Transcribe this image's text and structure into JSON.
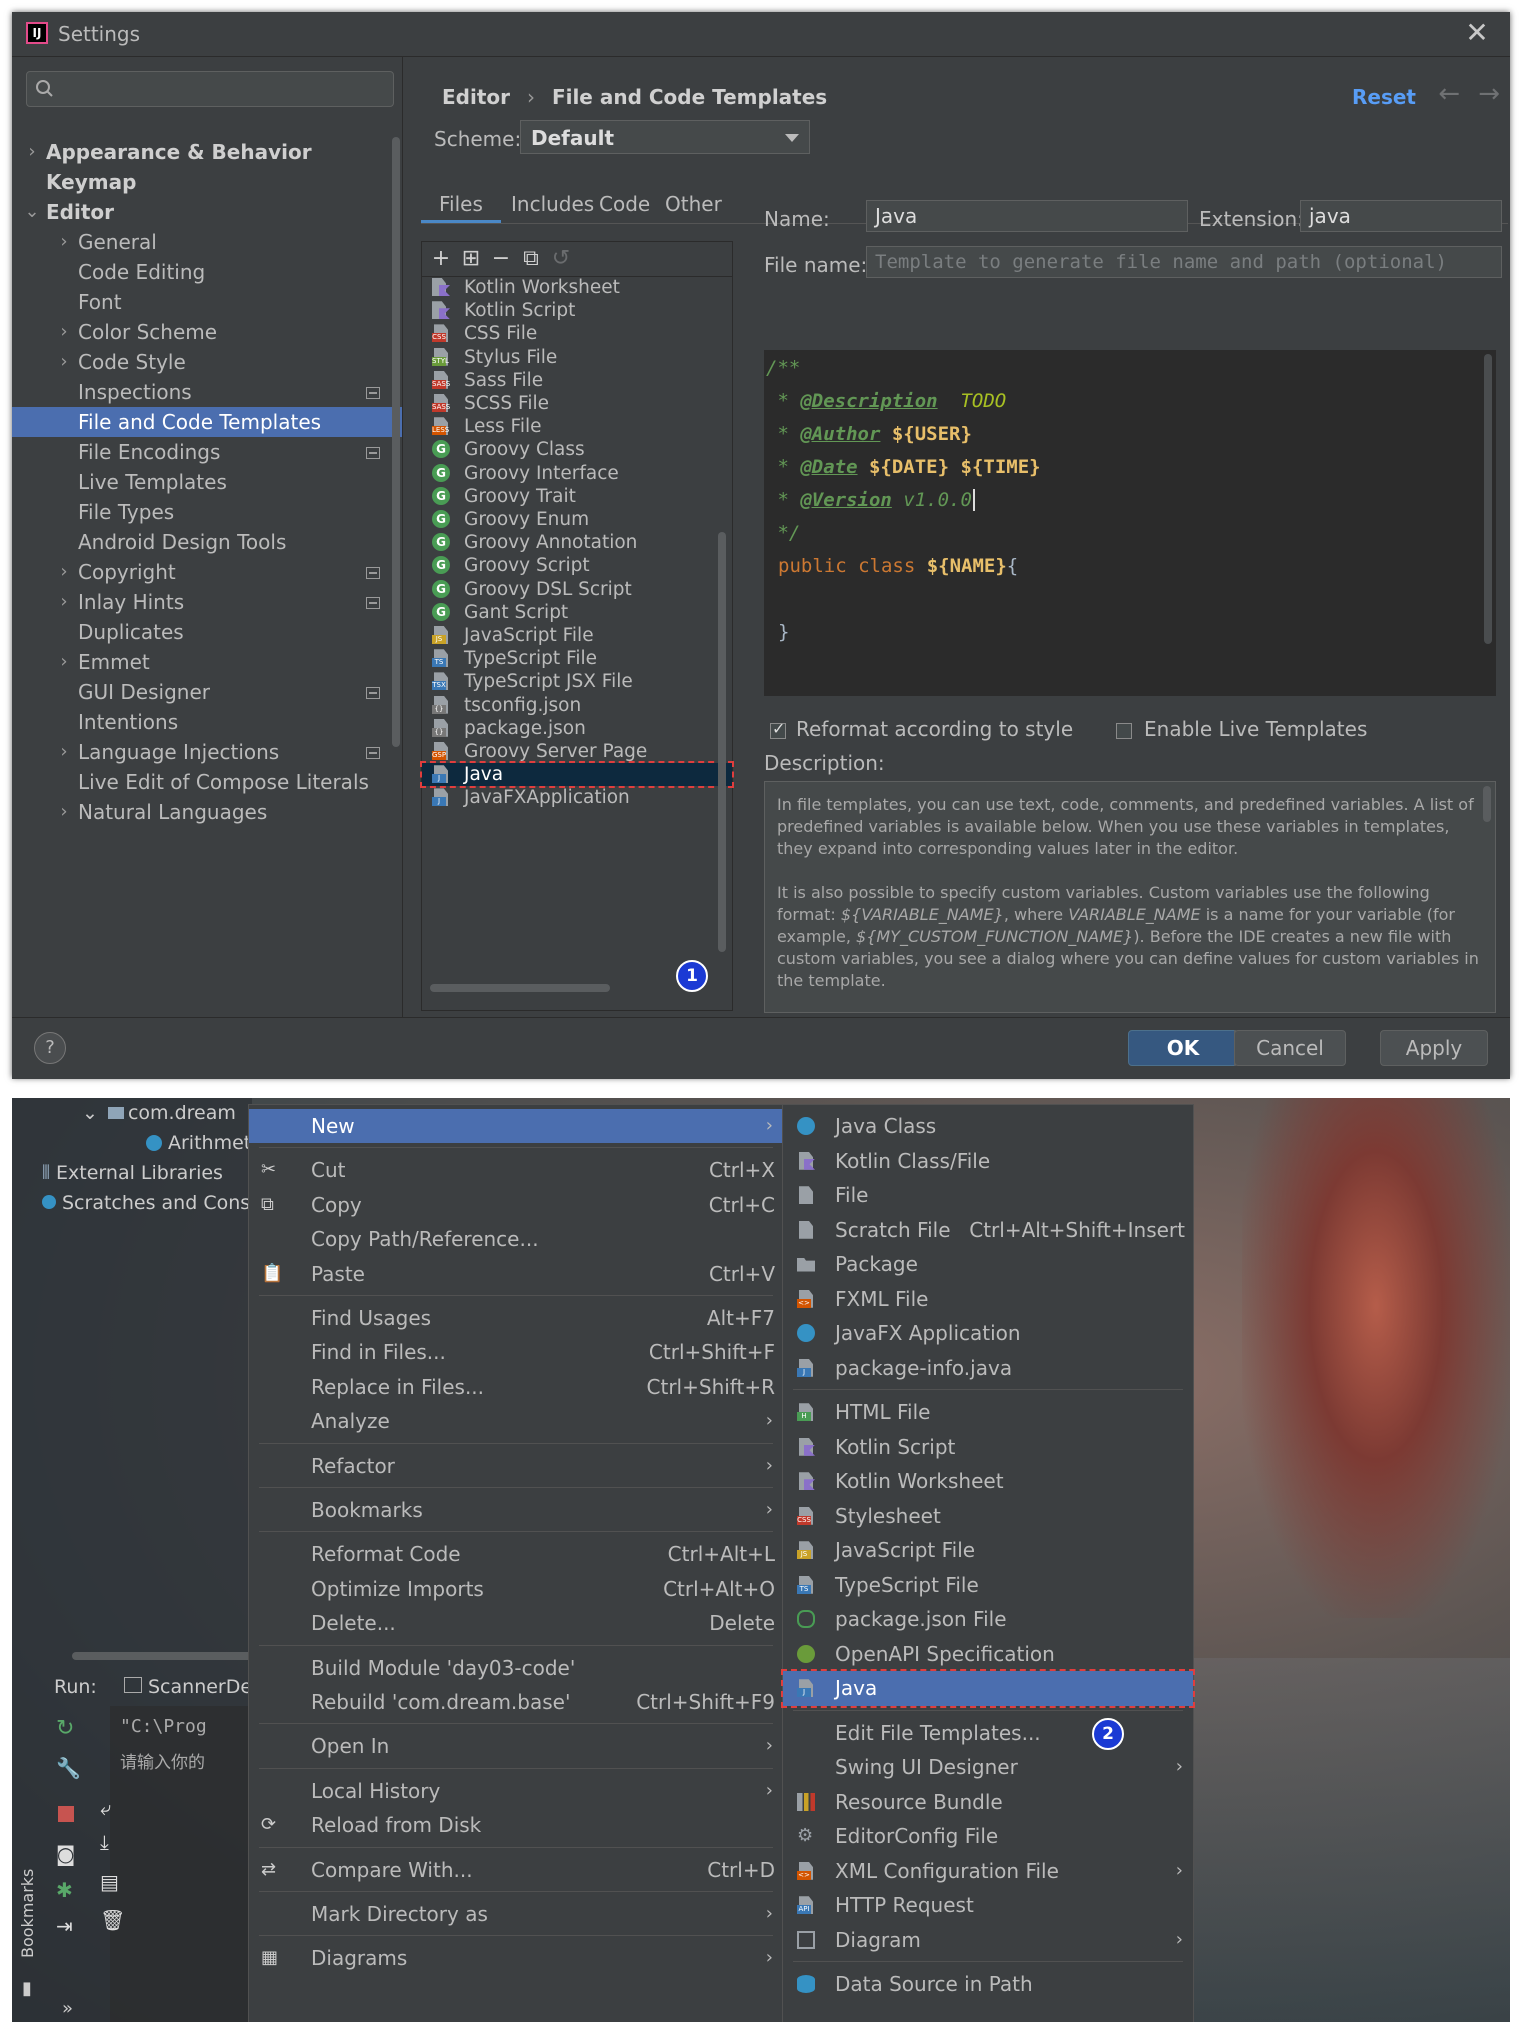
{
  "settings": {
    "title": "Settings",
    "close_symbol": "✕",
    "search_placeholder": "",
    "nav": [
      {
        "label": "Appearance & Behavior",
        "arrow": "›",
        "indent": 0,
        "bold": true
      },
      {
        "label": "Keymap",
        "arrow": "",
        "indent": 0,
        "bold": true
      },
      {
        "label": "Editor",
        "arrow": "⌄",
        "indent": 0,
        "bold": true
      },
      {
        "label": "General",
        "arrow": "›",
        "indent": 1
      },
      {
        "label": "Code Editing",
        "arrow": "",
        "indent": 1
      },
      {
        "label": "Font",
        "arrow": "",
        "indent": 1
      },
      {
        "label": "Color Scheme",
        "arrow": "›",
        "indent": 1
      },
      {
        "label": "Code Style",
        "arrow": "›",
        "indent": 1
      },
      {
        "label": "Inspections",
        "arrow": "",
        "indent": 1,
        "badge": true
      },
      {
        "label": "File and Code Templates",
        "arrow": "",
        "indent": 1,
        "selected": true
      },
      {
        "label": "File Encodings",
        "arrow": "",
        "indent": 1,
        "badge": true
      },
      {
        "label": "Live Templates",
        "arrow": "",
        "indent": 1
      },
      {
        "label": "File Types",
        "arrow": "",
        "indent": 1
      },
      {
        "label": "Android Design Tools",
        "arrow": "",
        "indent": 1
      },
      {
        "label": "Copyright",
        "arrow": "›",
        "indent": 1,
        "badge": true
      },
      {
        "label": "Inlay Hints",
        "arrow": "›",
        "indent": 1,
        "badge": true
      },
      {
        "label": "Duplicates",
        "arrow": "",
        "indent": 1
      },
      {
        "label": "Emmet",
        "arrow": "›",
        "indent": 1
      },
      {
        "label": "GUI Designer",
        "arrow": "",
        "indent": 1,
        "badge": true
      },
      {
        "label": "Intentions",
        "arrow": "",
        "indent": 1
      },
      {
        "label": "Language Injections",
        "arrow": "›",
        "indent": 1,
        "badge": true
      },
      {
        "label": "Live Edit of Compose Literals",
        "arrow": "",
        "indent": 1
      },
      {
        "label": "Natural Languages",
        "arrow": "›",
        "indent": 1
      }
    ],
    "breadcrumb": {
      "parent": "Editor",
      "sep": "›",
      "current": "File and Code Templates"
    },
    "reset_label": "Reset",
    "back_arrow": "←",
    "fwd_arrow": "→",
    "scheme_label": "Scheme:",
    "scheme_value": "Default",
    "tabs": [
      "Files",
      "Includes",
      "Code",
      "Other"
    ],
    "toolbar_icons": [
      "plus-icon",
      "add-child-icon",
      "minus-icon",
      "copy-icon",
      "revert-icon"
    ],
    "toolbar_glyphs": [
      "+",
      "⊞",
      "−",
      "⧉",
      "↺"
    ],
    "files": [
      {
        "label": "Kotlin Worksheet",
        "icon": "kotlin",
        "color": "#8a70c9"
      },
      {
        "label": "Kotlin Script",
        "icon": "kotlin",
        "color": "#8a70c9"
      },
      {
        "label": "CSS File",
        "icon": "file",
        "tag": "CSS",
        "color": "#c0392b"
      },
      {
        "label": "Stylus File",
        "icon": "file",
        "tag": "STYL",
        "color": "#6a9b3a"
      },
      {
        "label": "Sass File",
        "icon": "file",
        "tag": "SASS",
        "color": "#c0392b"
      },
      {
        "label": "SCSS File",
        "icon": "file",
        "tag": "SASS",
        "color": "#c0392b"
      },
      {
        "label": "Less File",
        "icon": "file",
        "tag": "LESS",
        "color": "#d35400"
      },
      {
        "label": "Groovy Class",
        "icon": "g"
      },
      {
        "label": "Groovy Interface",
        "icon": "g"
      },
      {
        "label": "Groovy Trait",
        "icon": "g"
      },
      {
        "label": "Groovy Enum",
        "icon": "g"
      },
      {
        "label": "Groovy Annotation",
        "icon": "g"
      },
      {
        "label": "Groovy Script",
        "icon": "g"
      },
      {
        "label": "Groovy DSL Script",
        "icon": "g"
      },
      {
        "label": "Gant Script",
        "icon": "g"
      },
      {
        "label": "JavaScript File",
        "icon": "file",
        "tag": "JS",
        "color": "#c9a227"
      },
      {
        "label": "TypeScript File",
        "icon": "file",
        "tag": "TS",
        "color": "#3a78b5"
      },
      {
        "label": "TypeScript JSX File",
        "icon": "file",
        "tag": "TSX",
        "color": "#3a78b5"
      },
      {
        "label": "tsconfig.json",
        "icon": "file",
        "tag": "{}",
        "color": "#777"
      },
      {
        "label": "package.json",
        "icon": "file",
        "tag": "{}",
        "color": "#777"
      },
      {
        "label": "Groovy Server Page",
        "icon": "file",
        "tag": "GSP",
        "color": "#d35400"
      },
      {
        "label": "Java",
        "icon": "file",
        "tag": "J",
        "color": "#3a78b5",
        "selected": true
      },
      {
        "label": "JavaFXApplication",
        "icon": "file",
        "tag": "J",
        "color": "#3a78b5"
      }
    ],
    "badge_1": "1",
    "name_label": "Name:",
    "name_value": "Java",
    "ext_label": "Extension:",
    "ext_value": "java",
    "filename_label": "File name:",
    "filename_placeholder": "Template to generate file name and path (optional)",
    "code": {
      "l1": "/**",
      "l2_star": " * ",
      "l2_tag": "@Description",
      "l2_rest": "  TODO",
      "l3_star": " * ",
      "l3_tag": "@Author",
      "l3_var": "${USER}",
      "l4_star": " * ",
      "l4_tag": "@Date",
      "l4_var1": "${DATE}",
      "l4_var2": "${TIME}",
      "l5_star": " * ",
      "l5_tag": "@Version",
      "l5_rest": " v1.0.0",
      "l6": " */",
      "l7_kw": "public class ",
      "l7_var": "${NAME}",
      "l7_rest": "{",
      "l9": "}"
    },
    "reformat_label": "Reformat according to style",
    "live_label": "Enable Live Templates",
    "desc_label": "Description:",
    "desc_p1": "In file templates, you can use text, code, comments, and predefined variables. A list of predefined variables is available below. When you use these variables in templates, they expand into corresponding values later in the editor.",
    "desc_p2a": "It is also possible to specify custom variables. Custom variables use the following format: ",
    "desc_p2b": "${VARIABLE_NAME}",
    "desc_p2c": ", where ",
    "desc_p2d": "VARIABLE_NAME",
    "desc_p2e": " is a name for your variable (for example, ",
    "desc_p2f": "${MY_CUSTOM_FUNCTION_NAME}",
    "desc_p2g": "). Before the IDE creates a new file with custom variables, you see a dialog where you can define values for custom variables in the template.",
    "help_label": "?",
    "ok_label": "OK",
    "cancel_label": "Cancel",
    "apply_label": "Apply"
  },
  "ide": {
    "tree": [
      {
        "label": "com.dream",
        "arrow": "⌄"
      },
      {
        "label": "Arithmet"
      },
      {
        "label": "External Libraries"
      },
      {
        "label": "Scratches and Conso"
      }
    ],
    "run_label": "Run:",
    "run_tab": "ScannerDe",
    "console_line1": "\"C:\\Prog",
    "console_line2": "请输入你的",
    "bookmarks_label": "Bookmarks",
    "more_glyph": "»",
    "context_menu": [
      {
        "label": "New",
        "sub": true,
        "hl": true
      },
      {
        "sep": true
      },
      {
        "label": "Cut",
        "sc": "Ctrl+X",
        "icon": "scissors-icon",
        "glyph": "✂"
      },
      {
        "label": "Copy",
        "sc": "Ctrl+C",
        "icon": "copy-icon",
        "glyph": "⧉"
      },
      {
        "label": "Copy Path/Reference..."
      },
      {
        "label": "Paste",
        "sc": "Ctrl+V",
        "icon": "paste-icon",
        "glyph": "📋"
      },
      {
        "sep": true
      },
      {
        "label": "Find Usages",
        "sc": "Alt+F7"
      },
      {
        "label": "Find in Files...",
        "sc": "Ctrl+Shift+F"
      },
      {
        "label": "Replace in Files...",
        "sc": "Ctrl+Shift+R"
      },
      {
        "label": "Analyze",
        "sub": true
      },
      {
        "sep": true
      },
      {
        "label": "Refactor",
        "sub": true
      },
      {
        "sep": true
      },
      {
        "label": "Bookmarks",
        "sub": true
      },
      {
        "sep": true
      },
      {
        "label": "Reformat Code",
        "sc": "Ctrl+Alt+L"
      },
      {
        "label": "Optimize Imports",
        "sc": "Ctrl+Alt+O"
      },
      {
        "label": "Delete...",
        "sc": "Delete"
      },
      {
        "sep": true
      },
      {
        "label": "Build Module 'day03-code'"
      },
      {
        "label": "Rebuild 'com.dream.base'",
        "sc": "Ctrl+Shift+F9"
      },
      {
        "sep": true
      },
      {
        "label": "Open In",
        "sub": true
      },
      {
        "sep": true
      },
      {
        "label": "Local History",
        "sub": true
      },
      {
        "label": "Reload from Disk",
        "icon": "reload-icon",
        "glyph": "⟳"
      },
      {
        "sep": true
      },
      {
        "label": "Compare With...",
        "sc": "Ctrl+D",
        "icon": "compare-icon",
        "glyph": "⇄"
      },
      {
        "sep": true
      },
      {
        "label": "Mark Directory as",
        "sub": true
      },
      {
        "sep": true
      },
      {
        "label": "Diagrams",
        "sub": true,
        "icon": "diagram-icon",
        "glyph": "▦"
      }
    ],
    "new_menu": [
      {
        "label": "Java Class",
        "icon": "class",
        "color": "#3592c4"
      },
      {
        "label": "Kotlin Class/File",
        "icon": "kotlin",
        "color": "#8a70c9"
      },
      {
        "label": "File",
        "icon": "file",
        "color": "#9aa0a6"
      },
      {
        "label": "Scratch File",
        "sc": "Ctrl+Alt+Shift+Insert",
        "icon": "file",
        "color": "#9aa0a6"
      },
      {
        "label": "Package",
        "icon": "folder",
        "color": "#9aa0a6"
      },
      {
        "label": "FXML File",
        "icon": "file",
        "tag": "<>",
        "color": "#d35400"
      },
      {
        "label": "JavaFX Application",
        "icon": "class",
        "color": "#3592c4"
      },
      {
        "label": "package-info.java",
        "icon": "file",
        "tag": "J",
        "color": "#3a78b5"
      },
      {
        "sep": true
      },
      {
        "label": "HTML File",
        "icon": "file",
        "tag": "H",
        "color": "#499c54"
      },
      {
        "label": "Kotlin Script",
        "icon": "kotlin",
        "color": "#8a70c9"
      },
      {
        "label": "Kotlin Worksheet",
        "icon": "kotlin",
        "color": "#8a70c9"
      },
      {
        "label": "Stylesheet",
        "icon": "file",
        "tag": "CSS",
        "color": "#c0392b"
      },
      {
        "label": "JavaScript File",
        "icon": "file",
        "tag": "JS",
        "color": "#c9a227"
      },
      {
        "label": "TypeScript File",
        "icon": "file",
        "tag": "TS",
        "color": "#3a78b5"
      },
      {
        "label": "package.json File",
        "icon": "hex",
        "color": "#499c54"
      },
      {
        "label": "OpenAPI Specification",
        "icon": "api",
        "color": "#6a9b3a"
      },
      {
        "label": "Java",
        "icon": "file",
        "tag": "J",
        "color": "#3a78b5",
        "selected": true
      },
      {
        "sep": true
      },
      {
        "label": "Edit File Templates..."
      },
      {
        "label": "Swing UI Designer",
        "sub": true
      },
      {
        "label": "Resource Bundle",
        "icon": "bars",
        "color": "#c9a227"
      },
      {
        "label": "EditorConfig File",
        "icon": "gear",
        "color": "#9aa0a6"
      },
      {
        "label": "XML Configuration File",
        "sub": true,
        "icon": "file",
        "tag": "<>",
        "color": "#d35400"
      },
      {
        "label": "HTTP Request",
        "icon": "file",
        "tag": "API",
        "color": "#3a78b5"
      },
      {
        "label": "Diagram",
        "sub": true,
        "icon": "diagram",
        "color": "#9aa0a6"
      },
      {
        "sep": true
      },
      {
        "label": "Data Source in Path",
        "icon": "db",
        "color": "#3592c4"
      }
    ],
    "badge_2": "2"
  }
}
